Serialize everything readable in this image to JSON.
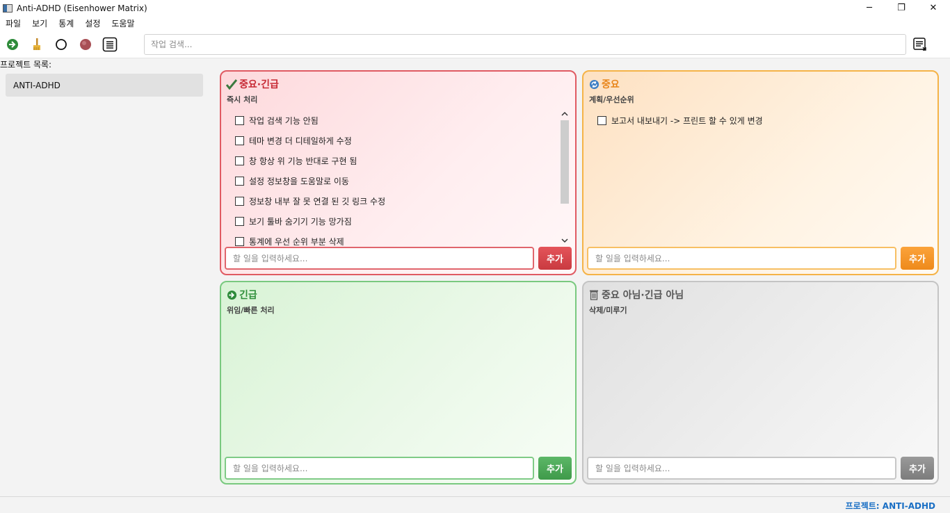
{
  "window": {
    "title": "Anti-ADHD (Eisenhower Matrix)",
    "minimize": "─",
    "maximize": "❐",
    "close": "✕"
  },
  "menu": [
    "파일",
    "보기",
    "통계",
    "설정",
    "도움말"
  ],
  "toolbar": {
    "icons": [
      "arrow-right-circle-icon",
      "broom-icon",
      "circle-outline-icon",
      "record-dot-icon",
      "list-icon"
    ],
    "search_placeholder": "작업 검색...",
    "right_icon": "export-list-icon"
  },
  "sidebar": {
    "label": "프로젝트 목록:",
    "projects": [
      "ANTI-ADHD"
    ]
  },
  "quadrants": {
    "q1": {
      "icon": "checkmark-icon",
      "title": "중요·긴급",
      "subtitle": "즉시 처리",
      "tasks": [
        "작업 검색 기능 안됨",
        "테마 변경 더 디테일하게 수정",
        "창 항상 위 기능 반대로 구현 됨",
        "설정 정보창을 도움말로 이동",
        "정보창 내부 잘 못 연결 된 깃 링크 수정",
        "보기 툴바 숨기기 기능 망가짐",
        "통계에 우선 순위 부분 삭제"
      ],
      "input_placeholder": "할 일을 입력하세요...",
      "add_label": "추가",
      "color": "#e05a62"
    },
    "q2": {
      "icon": "refresh-icon",
      "title": "중요",
      "subtitle": "계획/우선순위",
      "tasks": [
        "보고서 내보내기 -> 프린트 할 수 있게 변경"
      ],
      "input_placeholder": "할 일을 입력하세요...",
      "add_label": "추가",
      "color": "#f5b347"
    },
    "q3": {
      "icon": "arrow-right-circle-icon",
      "title": "긴급",
      "subtitle": "위임/빠른 처리",
      "tasks": [],
      "input_placeholder": "할 일을 입력하세요...",
      "add_label": "추가",
      "color": "#79c97f"
    },
    "q4": {
      "icon": "trash-icon",
      "title": "중요 아님·긴급 아님",
      "subtitle": "삭제/미루기",
      "tasks": [],
      "input_placeholder": "할 일을 입력하세요...",
      "add_label": "추가",
      "color": "#c4c4c4"
    }
  },
  "status": {
    "text": "프로젝트: ANTI-ADHD"
  }
}
